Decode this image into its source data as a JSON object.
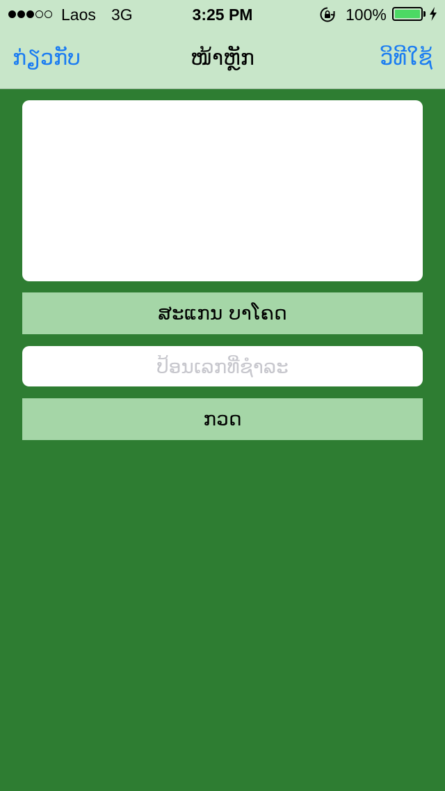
{
  "status_bar": {
    "carrier": "Laos",
    "network": "3G",
    "time": "3:25 PM",
    "battery_percent": "100%",
    "signal_bars_filled": 3,
    "signal_bars_total": 5,
    "battery_level": 1.0,
    "battery_color": "#4cd964",
    "icons": [
      "rotation-lock-icon",
      "battery-icon",
      "charging-icon"
    ]
  },
  "nav": {
    "left_label": "ກ່ຽວກັບ",
    "title": "ໜ້າຫຼັກ",
    "right_label": "ວິທີໃຊ້"
  },
  "main": {
    "scan_button_label": "ສະແກນ ບາໂຄດ",
    "number_input": {
      "placeholder": "ປ້ອນເລກທີ່ຊຳລະ",
      "value": ""
    },
    "check_button_label": "ກວດ"
  },
  "colors": {
    "background": "#2e7d32",
    "bar": "#c8e6c9",
    "button": "#a5d6a7",
    "link": "#1a7cf2"
  }
}
